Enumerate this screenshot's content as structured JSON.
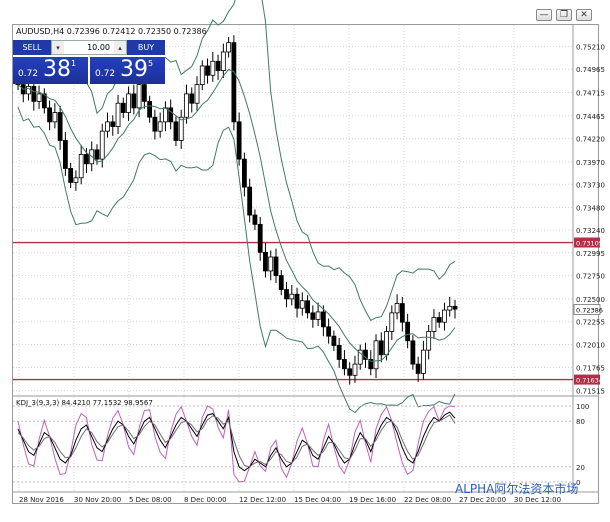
{
  "window": {
    "buttons": [
      "—",
      "❐",
      "✕"
    ]
  },
  "chart": {
    "title": "AUDUSD,H4  0.72396 0.72412 0.72350 0.72386"
  },
  "trade_panel": {
    "sell_label": "SELL",
    "buy_label": "BUY",
    "lot_value": "10.00",
    "sell_price": {
      "prefix": "0.72",
      "big": "38",
      "sup": "1"
    },
    "buy_price": {
      "prefix": "0.72",
      "big": "39",
      "sup": "5"
    }
  },
  "indicator": {
    "label": "KDJ_3(9,3,3) 84.4210 77.1532 98.9567"
  },
  "watermark": "ALPHA阿尔法资本市场",
  "price_axis": {
    "labels": [
      "0.75210",
      "0.74965",
      "0.74715",
      "0.74465",
      "0.74220",
      "0.73970",
      "0.73730",
      "0.73480",
      "0.73240",
      "0.72995",
      "0.72750",
      "0.72500",
      "0.72255",
      "0.72010",
      "0.71765",
      "0.71515"
    ],
    "tags": [
      {
        "label": "0.73105",
        "kind": "resistance"
      },
      {
        "label": "0.72386",
        "kind": "current"
      },
      {
        "label": "0.71634",
        "kind": "support"
      }
    ]
  },
  "kdj_axis": {
    "labels": [
      "100",
      "80",
      "20",
      "0"
    ]
  },
  "time_axis": {
    "labels": [
      "28 Nov 2016",
      "30 Nov 20:00",
      "5 Dec 08:00",
      "8 Dec 00:00",
      "12 Dec 12:00",
      "15 Dec 04:00",
      "19 Dec 16:00",
      "22 Dec 08:00",
      "27 Dec 20:00",
      "30 Dec 12:00"
    ]
  },
  "chart_data": {
    "type": "candlestick",
    "symbol": "AUDUSD",
    "timeframe": "H4",
    "ylim": [
      0.7149,
      0.753
    ],
    "horizontal_lines": [
      0.73105,
      0.71634
    ],
    "series": [
      {
        "name": "close",
        "values": [
          0.748,
          0.747,
          0.7478,
          0.7462,
          0.747,
          0.7455,
          0.744,
          0.745,
          0.742,
          0.739,
          0.7375,
          0.738,
          0.7405,
          0.7395,
          0.741,
          0.74,
          0.743,
          0.744,
          0.7435,
          0.746,
          0.745,
          0.747,
          0.7455,
          0.748,
          0.7462,
          0.7445,
          0.743,
          0.744,
          0.7455,
          0.744,
          0.742,
          0.7445,
          0.747,
          0.746,
          0.748,
          0.75,
          0.749,
          0.7505,
          0.7495,
          0.7515,
          0.7525,
          0.744,
          0.74,
          0.737,
          0.734,
          0.733,
          0.73,
          0.728,
          0.7295,
          0.7275,
          0.726,
          0.725,
          0.7255,
          0.724,
          0.7248,
          0.7235,
          0.7228,
          0.7236,
          0.722,
          0.721,
          0.72,
          0.7185,
          0.7175,
          0.7168,
          0.718,
          0.7195,
          0.7185,
          0.7175,
          0.7205,
          0.719,
          0.7215,
          0.7235,
          0.7245,
          0.7225,
          0.7205,
          0.718,
          0.717,
          0.7195,
          0.7215,
          0.723,
          0.7225,
          0.7238,
          0.7242,
          0.7239
        ]
      },
      {
        "name": "k",
        "values": [
          70,
          55,
          40,
          35,
          50,
          65,
          60,
          45,
          30,
          25,
          35,
          55,
          70,
          75,
          60,
          45,
          40,
          55,
          70,
          80,
          75,
          60,
          50,
          65,
          80,
          85,
          70,
          55,
          45,
          60,
          75,
          85,
          80,
          70,
          60,
          75,
          88,
          90,
          80,
          70,
          85,
          40,
          20,
          15,
          20,
          30,
          25,
          20,
          35,
          45,
          30,
          20,
          25,
          40,
          55,
          50,
          35,
          30,
          45,
          60,
          50,
          35,
          25,
          30,
          50,
          65,
          55,
          40,
          60,
          75,
          85,
          80,
          65,
          45,
          30,
          25,
          40,
          60,
          75,
          85,
          80,
          88,
          92,
          84
        ]
      },
      {
        "name": "d",
        "values": [
          65,
          58,
          48,
          42,
          47,
          57,
          60,
          52,
          40,
          32,
          33,
          45,
          60,
          70,
          65,
          53,
          46,
          52,
          63,
          73,
          75,
          67,
          57,
          62,
          73,
          80,
          75,
          63,
          52,
          57,
          68,
          78,
          80,
          75,
          66,
          70,
          82,
          87,
          84,
          76,
          80,
          55,
          35,
          22,
          20,
          25,
          27,
          23,
          30,
          40,
          36,
          27,
          25,
          33,
          47,
          50,
          42,
          35,
          40,
          52,
          52,
          42,
          32,
          30,
          42,
          57,
          57,
          47,
          55,
          68,
          78,
          80,
          72,
          55,
          40,
          30,
          35,
          50,
          66,
          78,
          80,
          84,
          88,
          77
        ]
      },
      {
        "name": "j",
        "values": [
          80,
          49,
          24,
          21,
          56,
          81,
          60,
          31,
          10,
          11,
          39,
          75,
          90,
          85,
          50,
          29,
          28,
          61,
          84,
          94,
          75,
          46,
          36,
          71,
          94,
          95,
          60,
          39,
          31,
          66,
          89,
          99,
          80,
          60,
          48,
          85,
          100,
          96,
          72,
          58,
          95,
          10,
          0,
          1,
          20,
          40,
          21,
          14,
          45,
          55,
          18,
          6,
          25,
          54,
          71,
          50,
          21,
          20,
          55,
          76,
          46,
          21,
          11,
          30,
          66,
          81,
          51,
          26,
          70,
          89,
          99,
          80,
          51,
          25,
          10,
          15,
          50,
          80,
          93,
          99,
          80,
          96,
          100,
          99
        ]
      }
    ]
  }
}
